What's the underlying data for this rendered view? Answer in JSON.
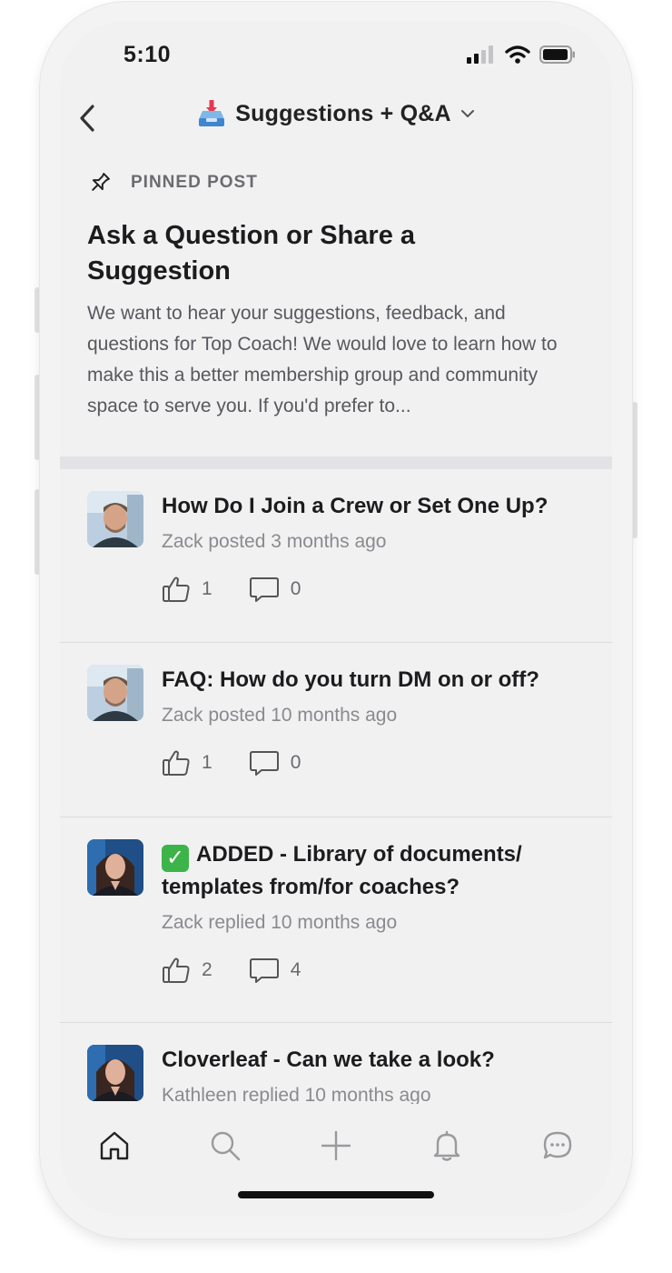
{
  "status_bar": {
    "time": "5:10"
  },
  "nav": {
    "title": "Suggestions + Q&A"
  },
  "pinned": {
    "label": "PINNED POST",
    "title": "Ask a Question or Share a Suggestion",
    "body": "We want to hear your suggestions, feedback, and questions for Top Coach! We would love to learn how to make this a better membership group and community space to serve you. If you'd prefer to..."
  },
  "posts": [
    {
      "title": "How Do I Join a Crew or Set One Up?",
      "meta": "Zack posted 3 months ago",
      "likes": "1",
      "comments": "0"
    },
    {
      "title": "FAQ: How do you turn DM on or off?",
      "meta": "Zack posted 10 months ago",
      "likes": "1",
      "comments": "0"
    },
    {
      "title": "ADDED - Library of documents/ templates from/for coaches?",
      "meta": "Zack replied 10 months ago",
      "likes": "2",
      "comments": "4"
    },
    {
      "title": "Cloverleaf - Can we take a look?",
      "meta": "Kathleen replied 10 months ago"
    }
  ],
  "tabs": [
    "home-icon",
    "search-icon",
    "plus-icon",
    "bell-icon",
    "chat-icon"
  ],
  "colors": {
    "check_green": "#3cb44a",
    "screen_bg": "#f1f1f2",
    "text_primary": "#1c1c1e",
    "text_secondary": "#8a8a8f"
  }
}
